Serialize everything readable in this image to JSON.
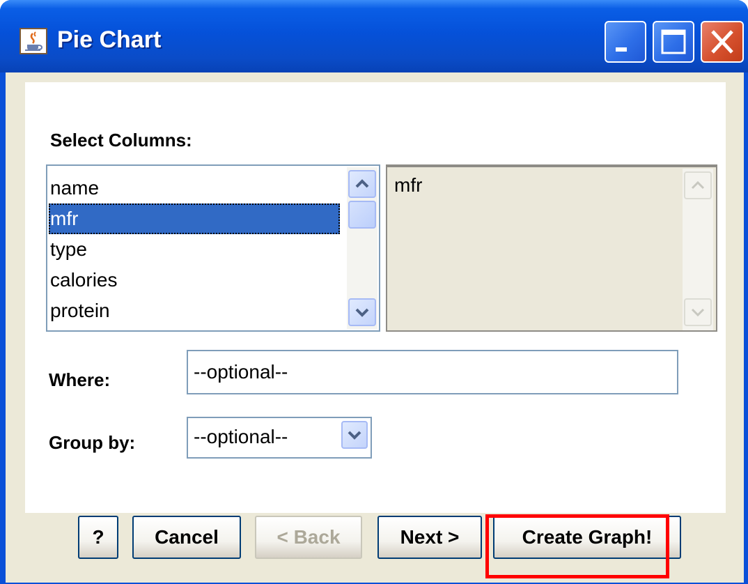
{
  "window": {
    "title": "Pie Chart",
    "icon": "java-cup-icon",
    "controls": [
      "minimize-icon",
      "maximize-icon",
      "close-icon"
    ]
  },
  "form": {
    "select_columns_label": "Select Columns:",
    "available_columns": [
      "name",
      "mfr",
      "type",
      "calories",
      "protein"
    ],
    "selected_available_index": 1,
    "chosen_columns": [
      "mfr"
    ],
    "where_label": "Where:",
    "where_value": "--optional--",
    "group_by_label": "Group by:",
    "group_by_value": "--optional--"
  },
  "buttons": {
    "help": "?",
    "cancel": "Cancel",
    "back": "< Back",
    "next": "Next >",
    "create": "Create Graph!"
  },
  "colors": {
    "highlight": "#ff0000",
    "selection": "#316ac5",
    "titlebar": "#0551d9"
  }
}
